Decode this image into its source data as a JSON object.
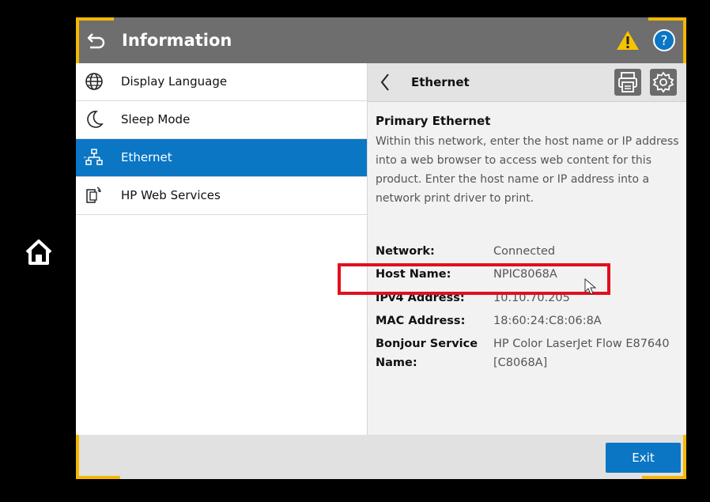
{
  "header": {
    "title": "Information"
  },
  "menu": {
    "items": [
      {
        "label": "Display Language"
      },
      {
        "label": "Sleep Mode"
      },
      {
        "label": "Ethernet"
      },
      {
        "label": "HP Web Services"
      }
    ],
    "selected": "Ethernet"
  },
  "detail": {
    "title": "Ethernet",
    "section_title": "Primary Ethernet",
    "description": "Within this network, enter the host name or IP address into a web browser to access web content for this product. Enter the host name or IP address into a network print driver to print.",
    "rows": [
      {
        "label": "Network:",
        "value": "Connected"
      },
      {
        "label": "Host Name:",
        "value": "NPIC8068A"
      },
      {
        "label": "IPv4 Address:",
        "value": "10.10.70.205"
      },
      {
        "label": "MAC Address:",
        "value": "18:60:24:C8:06:8A"
      },
      {
        "label": "Bonjour Service Name:",
        "value": "HP Color LaserJet Flow E87640 [C8068A]"
      }
    ]
  },
  "footer": {
    "exit_label": "Exit"
  },
  "colors": {
    "accent": "#0a76c4",
    "header_bg": "#6e6e6e",
    "highlight": "#e0101e",
    "corner": "#f5b800",
    "warning": "#f5c400"
  },
  "icons": [
    "home-icon",
    "back-arrow-icon",
    "warning-icon",
    "help-icon",
    "globe-icon",
    "moon-icon",
    "network-icon",
    "web-services-icon",
    "chevron-left-icon",
    "printer-icon",
    "gear-icon",
    "cursor-icon"
  ]
}
